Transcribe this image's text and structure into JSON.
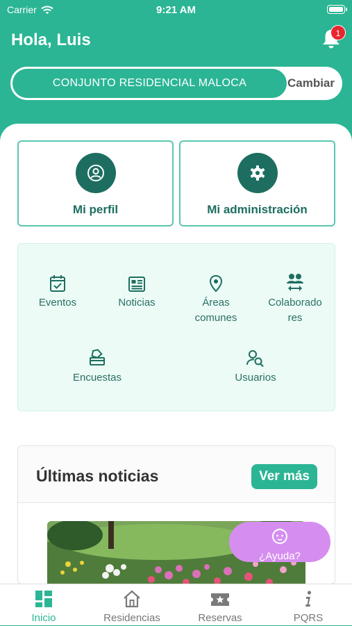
{
  "status_bar": {
    "carrier": "Carrier",
    "time": "9:21 AM"
  },
  "header": {
    "greeting": "Hola, Luis",
    "notification_count": "1"
  },
  "residence": {
    "name": "CONJUNTO RESIDENCIAL MALOCA",
    "change_label": "Cambiar"
  },
  "cards": {
    "profile": "Mi perfil",
    "admin": "Mi administración"
  },
  "grid": {
    "eventos": "Eventos",
    "noticias": "Noticias",
    "areas_1": "Áreas",
    "areas_2": "comunes",
    "colab_1": "Colaborado",
    "colab_2": "res",
    "encuestas": "Encuestas",
    "usuarios": "Usuarios"
  },
  "news": {
    "title": "Últimas noticias",
    "more_label": "Ver más"
  },
  "help": {
    "label": "¿Ayuda?"
  },
  "tabs": {
    "inicio": "Inicio",
    "residencias": "Residencias",
    "reservas": "Reservas",
    "pqrs": "PQRS"
  },
  "colors": {
    "primary": "#2bb594",
    "dark": "#1d6e60",
    "help": "#d58ef0",
    "badge": "#e8262f"
  }
}
